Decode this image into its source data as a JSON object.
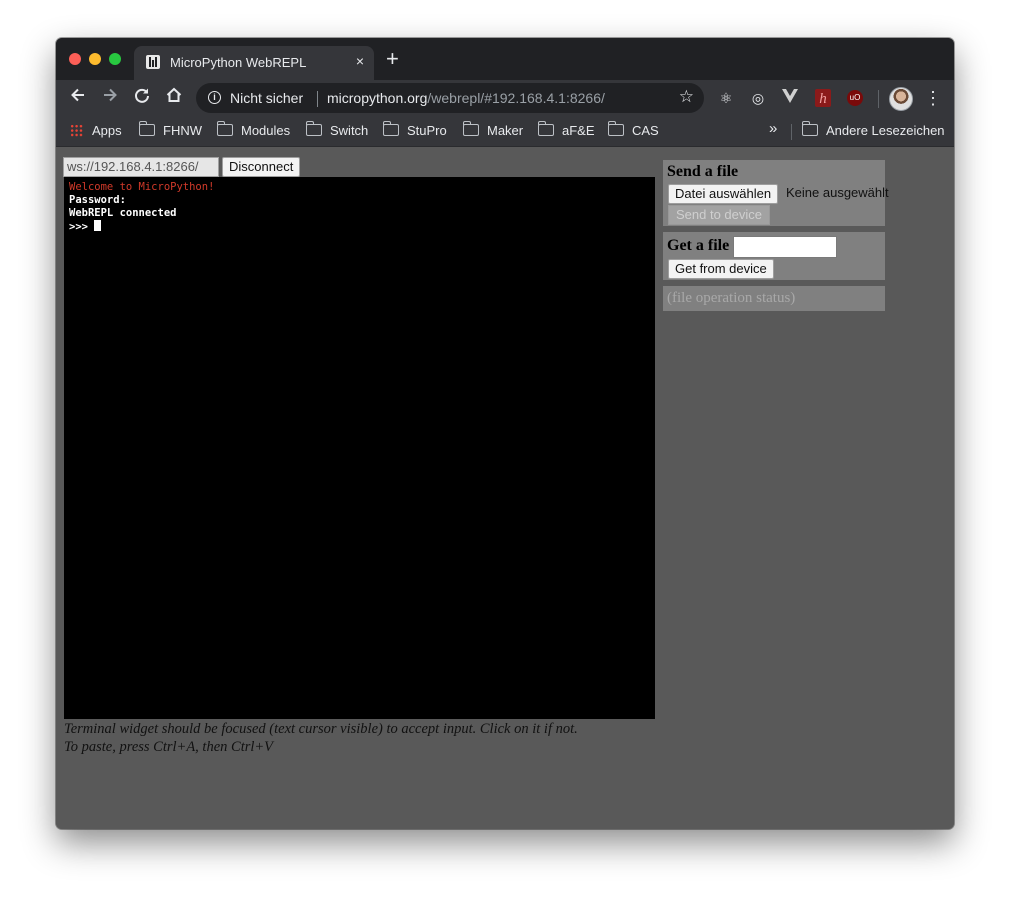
{
  "browser": {
    "tab_title": "MicroPython WebREPL",
    "tab_close": "×",
    "new_tab": "+",
    "security_label": "Nicht sicher",
    "url_host": "micropython.org",
    "url_path": "/webrepl/#192.168.4.1:8266/",
    "icons": [
      "back-icon",
      "forward-icon",
      "reload-icon",
      "home-icon",
      "info-icon",
      "star-icon",
      "react-icon",
      "target-icon",
      "vue-icon",
      "h-extension-icon",
      "ublock-icon",
      "profile-avatar",
      "more-menu-icon"
    ]
  },
  "bookmarks": {
    "items": [
      "Apps",
      "FHNW",
      "Modules",
      "Switch",
      "StuPro",
      "Maker",
      "aF&E",
      "CAS"
    ],
    "overflow": "»",
    "other": "Andere Lesezeichen"
  },
  "repl": {
    "ws_url": "ws://192.168.4.1:8266/",
    "connect_button": "Disconnect",
    "terminal_lines": [
      "Welcome to MicroPython!",
      "Password:",
      "WebREPL connected",
      ">>> "
    ],
    "hint_line1": "Terminal widget should be focused (text cursor visible) to accept input. Click on it if not.",
    "hint_line2": "To paste, press Ctrl+A, then Ctrl+V"
  },
  "send_file": {
    "title": "Send a file",
    "choose_button": "Datei auswählen",
    "no_file": "Keine ausgewählt",
    "send_button": "Send to device"
  },
  "get_file": {
    "title": "Get a file",
    "input_value": "",
    "get_button": "Get from device"
  },
  "status": {
    "text": "(file operation status)"
  },
  "colors": {
    "page_bg": "#595959",
    "panel_bg": "#808080",
    "terminal_bg": "#000000",
    "welcome_red": "#d23a2a"
  }
}
